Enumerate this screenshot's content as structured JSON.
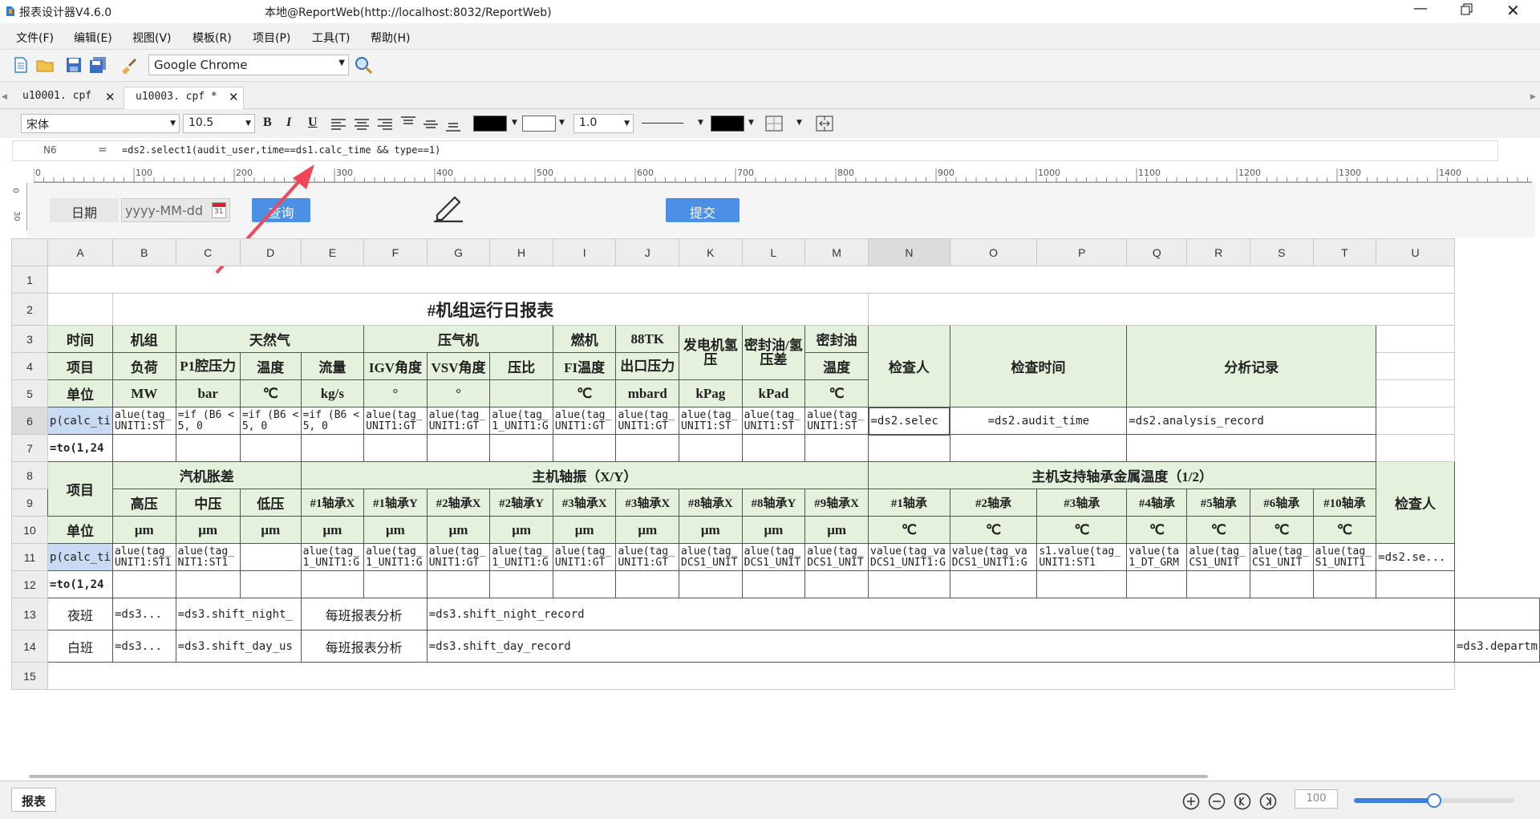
{
  "app": {
    "title": "报表设计器V4.6.0",
    "server": "本地@ReportWeb(http://localhost:8032/ReportWeb)"
  },
  "menu": [
    "文件(F)",
    "编辑(E)",
    "视图(V)",
    "模板(R)",
    "项目(P)",
    "工具(T)",
    "帮助(H)"
  ],
  "toolbar": {
    "browser": "Google Chrome"
  },
  "tabs": [
    {
      "label": "u10001. cpf"
    },
    {
      "label": "u10003. cpf *"
    }
  ],
  "format": {
    "font": "宋体",
    "size": "10.5",
    "line_width": "1.0"
  },
  "formula": {
    "cell": "N6",
    "eq": "=",
    "expr": "=ds2.select1(audit_user,time==ds1.calc_time && type==1)"
  },
  "ruler": {
    "v_labels": [
      "0",
      "30"
    ],
    "marks": [
      "0",
      "100",
      "200",
      "300",
      "400",
      "500",
      "600",
      "700",
      "800",
      "900",
      "1000",
      "1100",
      "1200",
      "1300",
      "1400"
    ]
  },
  "params": {
    "date_label": "日期",
    "date_placeholder": "yyyy-MM-dd",
    "calendar_day": "31",
    "query": "查询",
    "submit": "提交"
  },
  "columns": [
    "A",
    "B",
    "C",
    "D",
    "E",
    "F",
    "G",
    "H",
    "I",
    "J",
    "K",
    "L",
    "M",
    "N",
    "O",
    "P",
    "Q",
    "R",
    "S",
    "T",
    "U"
  ],
  "rows": [
    "1",
    "2",
    "3",
    "4",
    "5",
    "6",
    "7",
    "8",
    "9",
    "10",
    "11",
    "12",
    "13",
    "14",
    "15"
  ],
  "report": {
    "title": "#机组运行日报表",
    "r3": [
      "时间",
      "机组",
      "天然气",
      "压气机",
      "燃机",
      "88TK",
      "发电机氢压",
      "密封油/氢压差",
      "密封油",
      "检查人",
      "检查时间",
      "分析记录"
    ],
    "r4": [
      "项目",
      "负荷",
      "P1腔压力",
      "温度",
      "流量",
      "IGV角度",
      "VSV角度",
      "压比",
      "FI温度",
      "出口压力"
    ],
    "r4m": "温度",
    "r5": [
      "单位",
      "MW",
      "bar",
      "℃",
      "kg/s",
      "°",
      "°",
      "",
      "℃",
      "mbard",
      "kPag",
      "kPad",
      "℃"
    ],
    "r6": [
      "p(calc_ti",
      "alue(tag_ UNIT1:ST",
      "=if (B6 < 5, 0",
      "=if (B6 < 5, 0",
      "=if (B6 < 5, 0",
      "alue(tag_ UNIT1:GT",
      "alue(tag_ UNIT1:GT",
      "alue(tag_ 1_UNIT1:G",
      "alue(tag_ UNIT1:GT",
      "alue(tag_ UNIT1:GT",
      "alue(tag_ UNIT1:ST",
      "alue(tag_ UNIT1:ST",
      "alue(tag_ UNIT1:ST",
      "=ds2.selec",
      "=ds2.audit_time",
      "=ds2.analysis_record"
    ],
    "r7": "=to(1,24",
    "r8": [
      "项目",
      "汽机胀差",
      "主机轴振（X/Y）",
      "主机支持轴承金属温度（1/2）",
      "检查人"
    ],
    "r9": [
      "高压",
      "中压",
      "低压",
      "#1轴承X",
      "#1轴承Y",
      "#2轴承X",
      "#2轴承Y",
      "#3轴承X",
      "#3轴承X",
      "#8轴承X",
      "#8轴承Y",
      "#9轴承X",
      "#1轴承",
      "#2轴承",
      "#3轴承",
      "#4轴承",
      "#5轴承",
      "#6轴承",
      "#10轴承"
    ],
    "r10": [
      "单位",
      "μm",
      "μm",
      "μm",
      "μm",
      "μm",
      "μm",
      "μm",
      "μm",
      "μm",
      "μm",
      "μm",
      "μm",
      "℃",
      "℃",
      "℃",
      "℃",
      "℃",
      "℃",
      "℃"
    ],
    "r11": [
      "p(calc_ti",
      "alue(tag_ UNIT1:ST1",
      "alue(tag_ NIT1:ST1",
      "",
      "alue(tag_ 1_UNIT1:G",
      "alue(tag_ 1_UNIT1:G",
      "alue(tag_ UNIT1:GT",
      "alue(tag_ 1_UNIT1:G",
      "alue(tag_ UNIT1:GT",
      "alue(tag_ UNIT1:GT",
      "alue(tag_ DCS1_UNIT",
      "alue(tag_ DCS1_UNIT",
      "alue(tag_ DCS1_UNIT",
      "value(tag_va DCS1_UNIT1:G",
      "value(tag_va DCS1_UNIT1:G",
      "s1.value(tag_ UNIT1:ST1",
      "value(ta 1_DT_GRM",
      "alue(tag_ CS1_UNIT",
      "alue(tag_ CS1_UNIT",
      "alue(tag_ S1_UNIT1",
      "=ds2.se..."
    ],
    "r12": "=to(1,24",
    "r13": [
      "夜班",
      "=ds3...",
      "=ds3.shift_night_",
      "每班报表分析",
      "=ds3.shift_night_record"
    ],
    "r14": [
      "白班",
      "=ds3...",
      "=ds3.shift_day_us",
      "每班报表分析",
      "=ds3.shift_day_record",
      "=ds3.departm"
    ]
  },
  "bottom": {
    "sheet_tab": "报表",
    "zoom": "100",
    "zoom_fraction": 0.5
  }
}
